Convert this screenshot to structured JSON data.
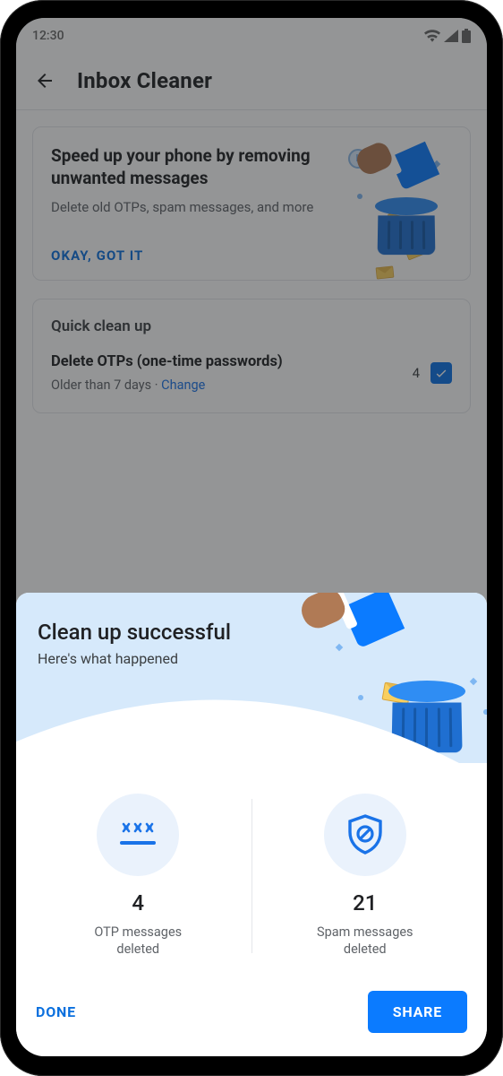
{
  "status": {
    "time": "12:30"
  },
  "header": {
    "title": "Inbox Cleaner"
  },
  "intro": {
    "title": "Speed up your phone by removing unwanted messages",
    "subtitle": "Delete old OTPs, spam messages, and more",
    "cta": "Okay, got it"
  },
  "quick": {
    "section_title": "Quick clean up",
    "row_title": "Delete OTPs (one-time passwords)",
    "row_sub_prefix": "Older than 7 days · ",
    "row_change": "Change",
    "count": "4"
  },
  "sheet": {
    "title": "Clean up successful",
    "subtitle": "Here's what happened",
    "stats": [
      {
        "count": "4",
        "label": "OTP messages deleted"
      },
      {
        "count": "21",
        "label": "Spam messages deleted"
      }
    ],
    "done": "DONE",
    "share": "SHARE"
  }
}
